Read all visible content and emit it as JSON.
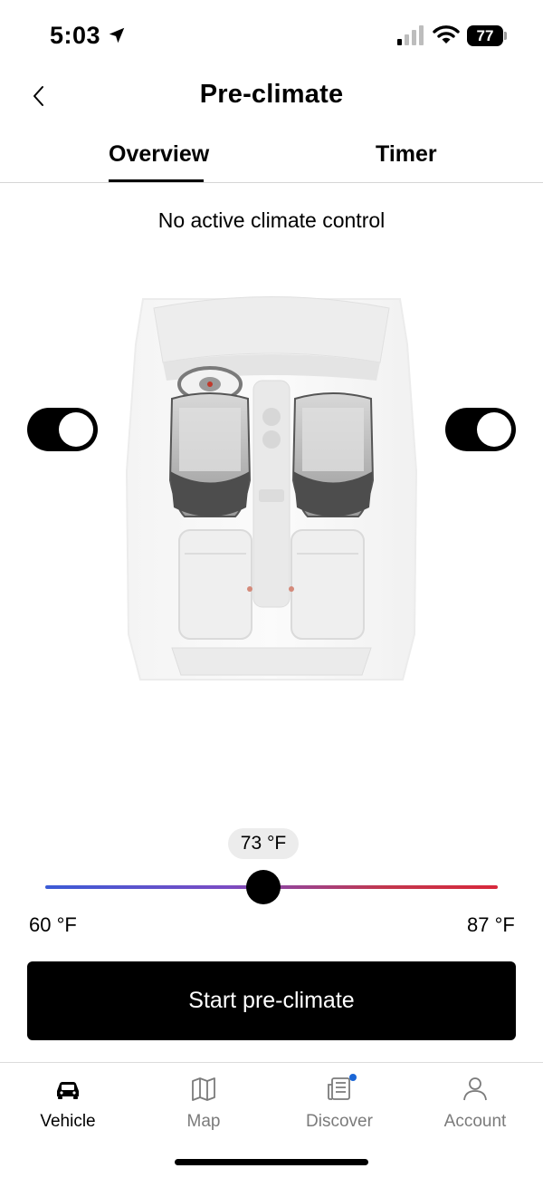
{
  "status_bar": {
    "time": "5:03",
    "battery_level": "77",
    "icons": [
      "location-arrow-icon",
      "signal-icon",
      "wifi-icon",
      "battery-icon"
    ]
  },
  "header": {
    "title": "Pre-climate",
    "back_icon": "chevron-left-icon"
  },
  "tabs": [
    {
      "label": "Overview",
      "active": true
    },
    {
      "label": "Timer",
      "active": false
    }
  ],
  "status_message": "No active climate control",
  "seat_heating": {
    "left_toggle_on": true,
    "right_toggle_on": true
  },
  "temperature": {
    "current_label": "73 °F",
    "current": 73,
    "min_label": "60 °F",
    "max_label": "87 °F",
    "min": 60,
    "max": 87,
    "colors": {
      "cold": "#3b5bd6",
      "hot": "#d8283b"
    }
  },
  "start_button_label": "Start pre-climate",
  "bottom_nav": [
    {
      "label": "Vehicle",
      "icon": "car-icon",
      "active": true
    },
    {
      "label": "Map",
      "icon": "map-icon",
      "active": false
    },
    {
      "label": "Discover",
      "icon": "news-icon",
      "active": false,
      "notification": true
    },
    {
      "label": "Account",
      "icon": "person-icon",
      "active": false
    }
  ]
}
